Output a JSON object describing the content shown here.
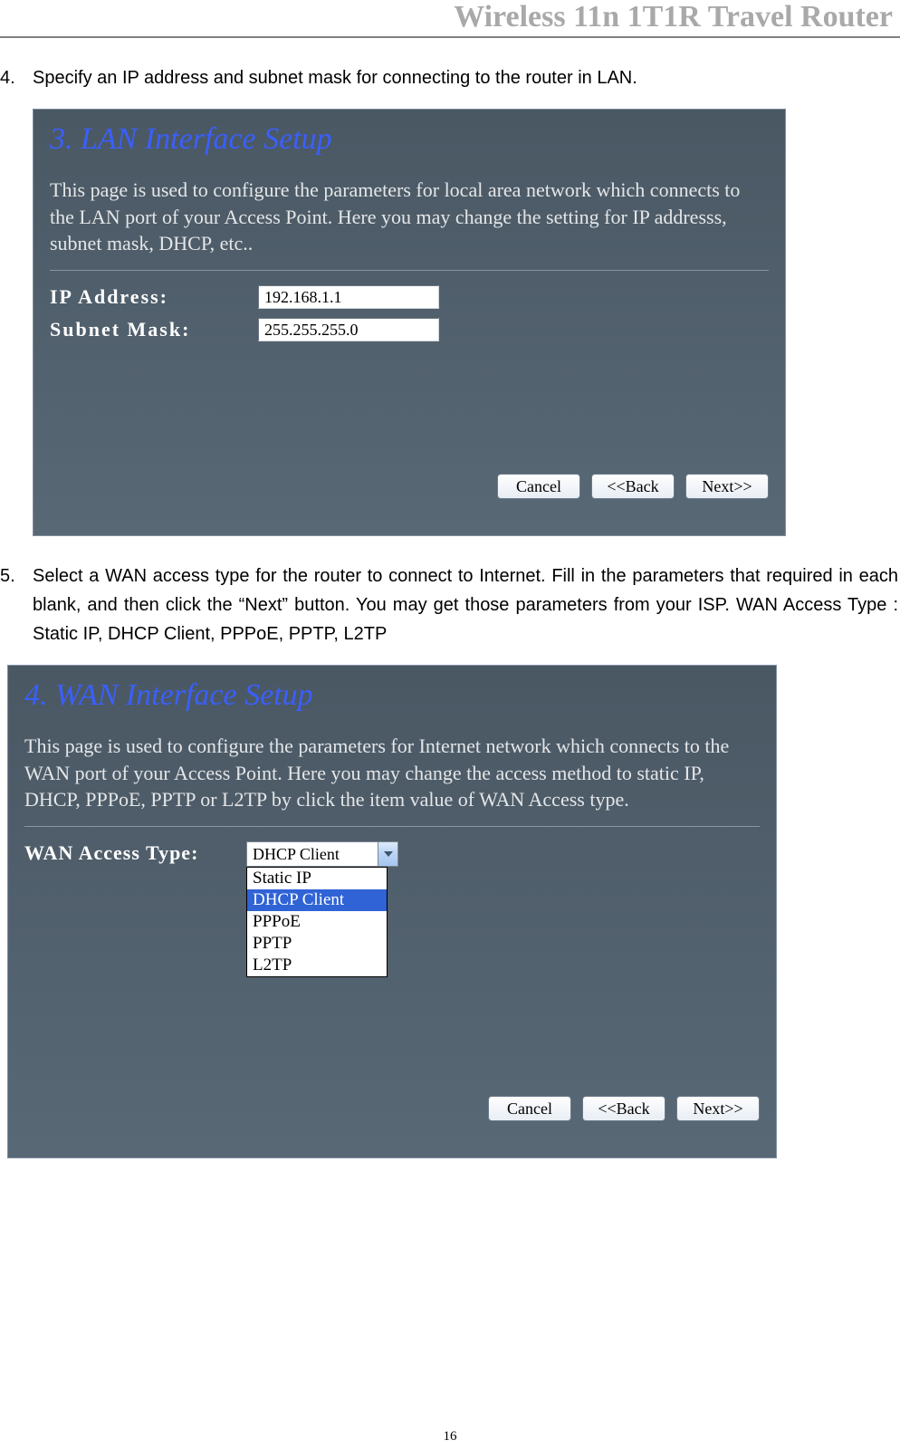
{
  "header": {
    "doc_title": "Wireless 11n 1T1R Travel Router"
  },
  "page_number": "16",
  "steps": {
    "s4": {
      "num": "4.",
      "text": "Specify an IP address and subnet mask for connecting to the router in LAN."
    },
    "s5": {
      "num": "5.",
      "text": "Select a WAN access type for the router to connect to Internet. Fill in the parameters that required in each blank, and then click the “Next” button. You may get those parameters from your ISP. WAN Access Type : Static IP, DHCP Client, PPPoE, PPTP, L2TP"
    }
  },
  "lan_panel": {
    "title": "3. LAN Interface Setup",
    "desc": "This page is used to configure the parameters for local area network which connects to the LAN port of your Access Point. Here you may change the setting for IP addresss, subnet mask, DHCP, etc..",
    "ip_label": "IP Address:",
    "ip_value": "192.168.1.1",
    "mask_label": "Subnet Mask:",
    "mask_value": "255.255.255.0",
    "btn_cancel": "Cancel",
    "btn_back": "<<Back",
    "btn_next": "Next>>"
  },
  "wan_panel": {
    "title": "4. WAN Interface Setup",
    "desc": "This page is used to configure the parameters for Internet network which connects to the WAN port of your Access Point. Here you may change the access method to static IP, DHCP, PPPoE, PPTP or L2TP by click the item value of WAN Access type.",
    "type_label": "WAN Access Type:",
    "type_value": "DHCP Client",
    "options": {
      "o1": "Static IP",
      "o2": "DHCP Client",
      "o3": "PPPoE",
      "o4": "PPTP",
      "o5": "L2TP"
    },
    "btn_cancel": "Cancel",
    "btn_back": "<<Back",
    "btn_next": "Next>>"
  }
}
